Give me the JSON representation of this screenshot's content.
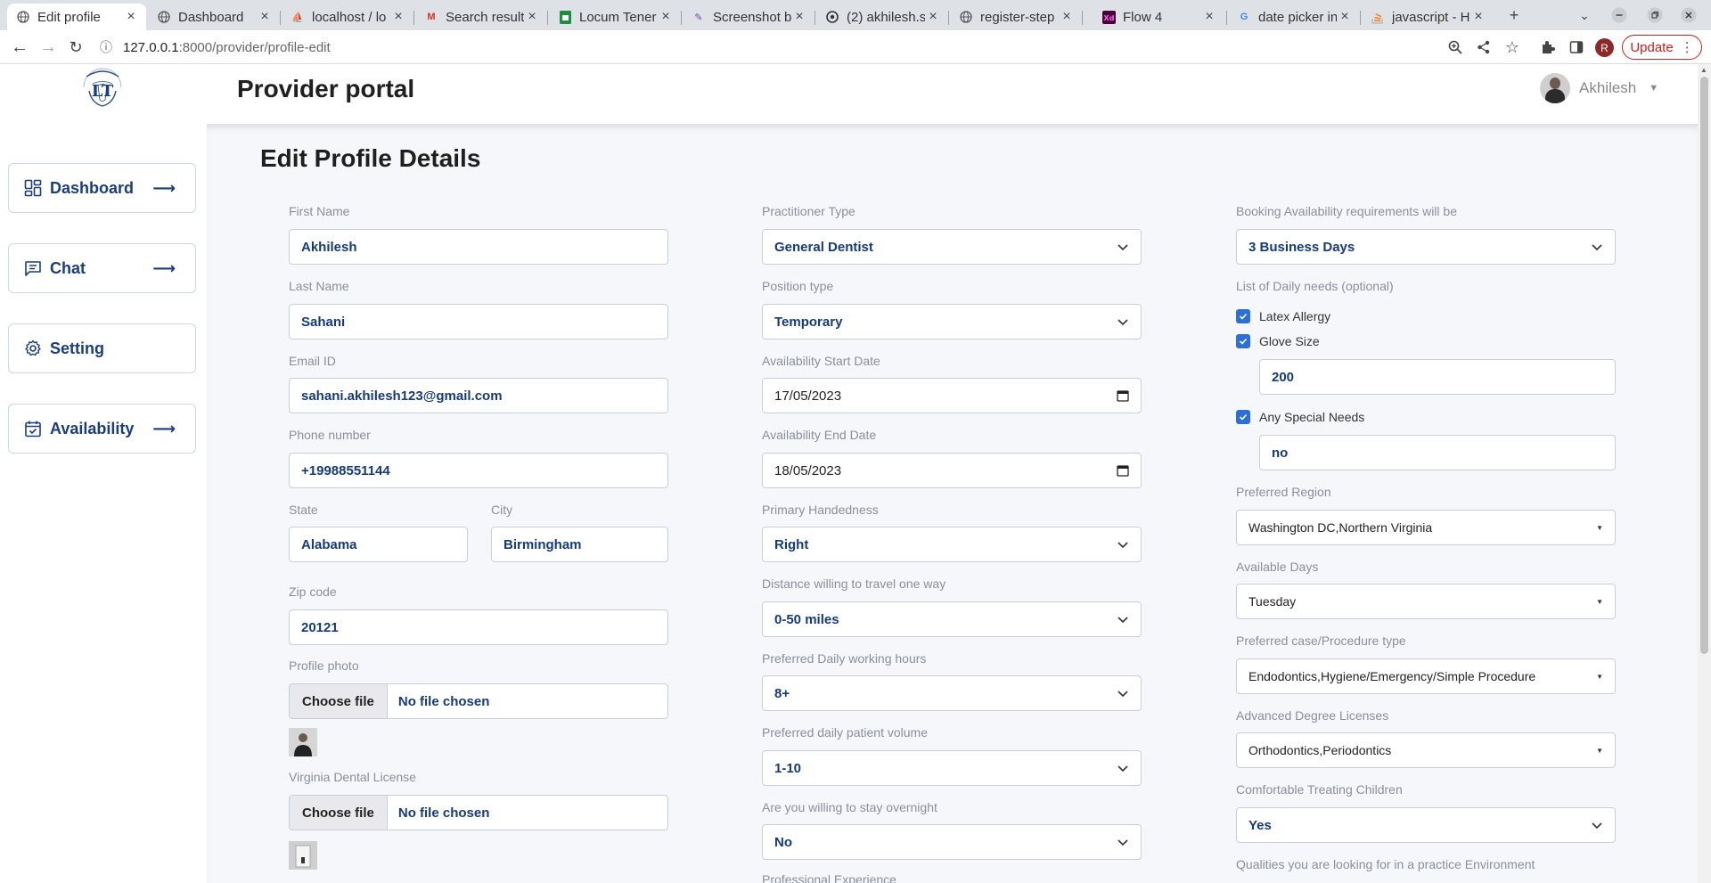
{
  "browser": {
    "tabs": [
      {
        "title": "Edit profile",
        "active": true
      },
      {
        "title": "Dashboard"
      },
      {
        "title": "localhost / lo"
      },
      {
        "title": "Search result"
      },
      {
        "title": "Locum Tener"
      },
      {
        "title": "Screenshot b"
      },
      {
        "title": "(2) akhilesh.s"
      },
      {
        "title": "register-step"
      },
      {
        "title": "Flow 4"
      },
      {
        "title": "date picker in"
      },
      {
        "title": "javascript - H"
      }
    ],
    "url_host": "127.0.0.1",
    "url_path": ":8000/provider/profile-edit",
    "profile_initial": "R",
    "update_label": "Update"
  },
  "header": {
    "portal_title": "Provider portal",
    "user_name": "Akhilesh"
  },
  "sidebar": {
    "items": [
      {
        "label": "Dashboard",
        "icon": "grid-icon"
      },
      {
        "label": "Chat",
        "icon": "chat-icon"
      },
      {
        "label": "Setting",
        "icon": "gear-icon"
      },
      {
        "label": "Availability",
        "icon": "calendar-check-icon"
      }
    ]
  },
  "form": {
    "title": "Edit Profile Details",
    "col1": {
      "first_name": {
        "label": "First Name",
        "value": "Akhilesh"
      },
      "last_name": {
        "label": "Last Name",
        "value": "Sahani"
      },
      "email": {
        "label": "Email ID",
        "value": "sahani.akhilesh123@gmail.com"
      },
      "phone": {
        "label": "Phone number",
        "value": "+19988551144"
      },
      "state": {
        "label": "State",
        "value": "Alabama"
      },
      "city": {
        "label": "City",
        "value": "Birmingham"
      },
      "zip": {
        "label": "Zip code",
        "value": "20121"
      },
      "profile_photo": {
        "label": "Profile photo",
        "button": "Choose file",
        "status": "No file chosen"
      },
      "license": {
        "label": "Virginia Dental License",
        "button": "Choose file",
        "status": "No file chosen"
      }
    },
    "col2": {
      "practitioner_type": {
        "label": "Practitioner Type",
        "value": "General Dentist"
      },
      "position_type": {
        "label": "Position type",
        "value": "Temporary"
      },
      "start_date": {
        "label": "Availability Start Date",
        "value": "17/05/2023"
      },
      "end_date": {
        "label": "Availability End Date",
        "value": "18/05/2023"
      },
      "handedness": {
        "label": "Primary Handedness",
        "value": "Right"
      },
      "distance": {
        "label": "Distance willing to travel one way",
        "value": "0-50 miles"
      },
      "hours": {
        "label": "Preferred Daily working hours",
        "value": "8+"
      },
      "patient_volume": {
        "label": "Preferred daily patient volume",
        "value": "1-10"
      },
      "overnight": {
        "label": "Are you willing to stay overnight",
        "value": "No"
      },
      "experience": {
        "label": "Professional Experience"
      }
    },
    "col3": {
      "booking": {
        "label": "Booking Availability requirements will be",
        "value": "3 Business Days"
      },
      "daily_needs": {
        "label": "List of Daily needs (optional)",
        "latex": {
          "label": "Latex Allergy",
          "checked": true
        },
        "glove": {
          "label": "Glove Size",
          "checked": true,
          "value": "200"
        },
        "special": {
          "label": "Any Special Needs",
          "checked": true,
          "value": "no"
        }
      },
      "region": {
        "label": "Preferred Region",
        "value": "Washington DC,Northern Virginia"
      },
      "days": {
        "label": "Available Days",
        "value": "Tuesday"
      },
      "procedure": {
        "label": "Preferred case/Procedure type",
        "value": "Endodontics,Hygiene/Emergency/Simple Procedure"
      },
      "licenses": {
        "label": "Advanced Degree Licenses",
        "value": "Orthodontics,Periodontics"
      },
      "children": {
        "label": "Comfortable Treating Children",
        "value": "Yes"
      },
      "qualities": {
        "label": "Qualities you are looking for in a practice Environment"
      }
    }
  },
  "colors": {
    "accent": "#1a3d7c",
    "field_text": "#173a7a",
    "checkbox": "#2d6fd6",
    "content_bg": "#f5f7fb"
  }
}
